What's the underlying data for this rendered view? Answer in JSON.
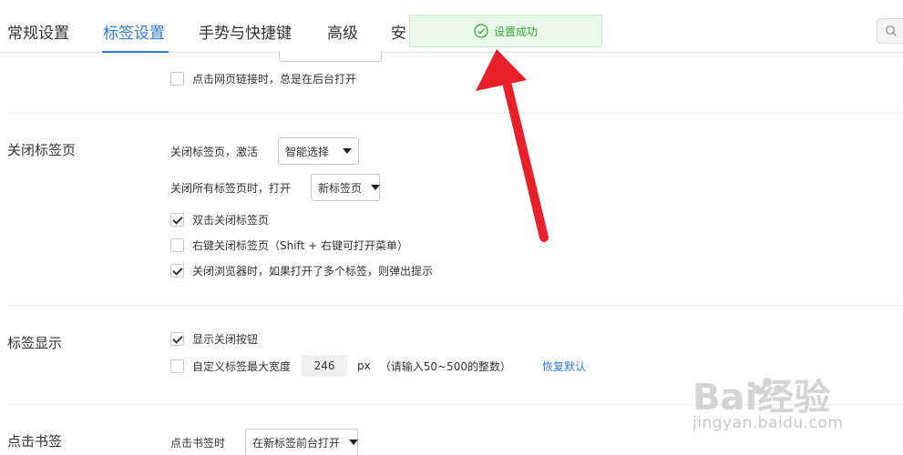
{
  "nav": {
    "tabs": [
      {
        "label": "常规设置"
      },
      {
        "label": "标签设置"
      },
      {
        "label": "手势与快捷键"
      },
      {
        "label": "高级"
      },
      {
        "label": "安"
      }
    ],
    "active_tab": "标签设置"
  },
  "toast": {
    "message": "设置成功"
  },
  "top_section": {
    "open_links_background": {
      "label": "点击网页链接时，总是在后台打开",
      "checked": false
    }
  },
  "close_tabs": {
    "title": "关闭标签页",
    "activate_label": "关闭标签页，激活",
    "activate_value": "智能选择",
    "close_all_label": "关闭所有标签页时，打开",
    "close_all_value": "新标签页",
    "options": [
      {
        "label": "双击关闭标签页",
        "checked": true
      },
      {
        "label": "右键关闭标签页（Shift + 右键可打开菜单）",
        "checked": false
      },
      {
        "label": "关闭浏览器时，如果打开了多个标签，则弹出提示",
        "checked": true
      }
    ]
  },
  "tab_display": {
    "title": "标签显示",
    "show_close": {
      "label": "显示关闭按钮",
      "checked": true
    },
    "custom_width": {
      "label": "自定义标签最大宽度",
      "checked": false,
      "value": "246",
      "unit": "px",
      "hint": "（请输入50~500的整数）",
      "reset_label": "恢复默认"
    }
  },
  "bookmark_click": {
    "title": "点击书签",
    "label": "点击书签时",
    "value": "在新标签前台打开"
  },
  "watermark": {
    "text": "jingyan.baidu.com",
    "brand": "Bai经验"
  },
  "colors": {
    "accent": "#2f7bd8",
    "success": "#3aa63a",
    "arrow": "#e8202a"
  }
}
